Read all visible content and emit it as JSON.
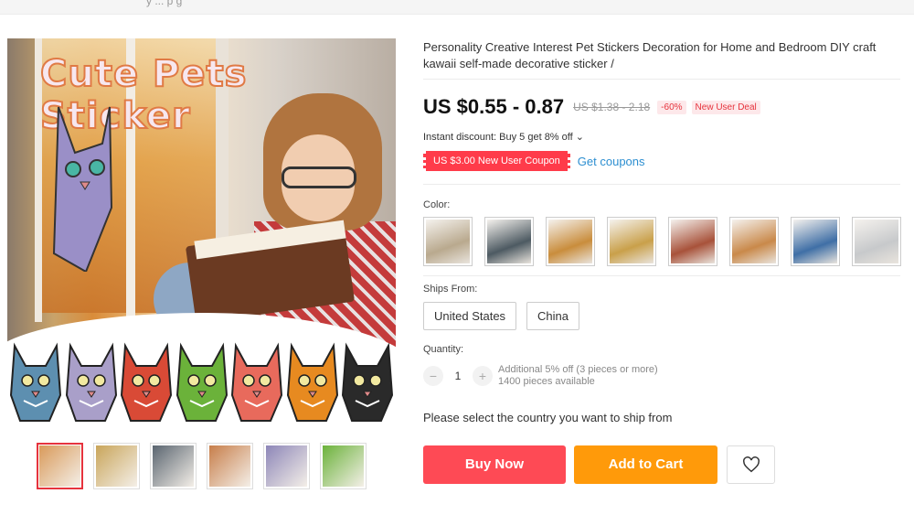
{
  "topbar": {
    "text": "y ... p g"
  },
  "gallery": {
    "headline": "Cute Pets Sticker",
    "sticker_colors": [
      "#5d8fb0",
      "#a99fc9",
      "#d94a36",
      "#6bb23a",
      "#e86a5c",
      "#e78a20",
      "#2a2a2a"
    ],
    "thumbnails": [
      {
        "name": "thumb-girl-reading-stickers",
        "color": "#d99a5a",
        "active": true
      },
      {
        "name": "thumb-sunny-room",
        "color": "#c9a55a",
        "active": false
      },
      {
        "name": "thumb-window-seat",
        "color": "#5a6570",
        "active": false
      },
      {
        "name": "thumb-girl-window",
        "color": "#c77e4a",
        "active": false
      },
      {
        "name": "thumb-grey-cat-sticker",
        "color": "#8d86b8",
        "active": false
      },
      {
        "name": "thumb-green-cat-sticker",
        "color": "#6bb23a",
        "active": false
      }
    ]
  },
  "product": {
    "title": "Personality Creative Interest Pet Stickers Decoration for Home and Bedroom DIY craft kawaii self-made decorative sticker /",
    "price": "US $0.55 - 0.87",
    "original_price": "US $1.38 - 2.18",
    "discount": "-60%",
    "new_user_deal": "New User Deal",
    "instant_discount": "Instant discount: Buy 5 get 8% off",
    "coupon": "US $3.00 New User Coupon",
    "get_coupons": "Get coupons",
    "color_label": "Color:",
    "color_swatches": [
      {
        "name": "swatch-grey-cat",
        "color": "#b9a98e"
      },
      {
        "name": "swatch-girl-reading",
        "color": "#4d5a62"
      },
      {
        "name": "swatch-window-cat",
        "color": "#c98d3c"
      },
      {
        "name": "swatch-flowers",
        "color": "#c9a04a"
      },
      {
        "name": "swatch-red-room",
        "color": "#a8523a"
      },
      {
        "name": "swatch-girl-window",
        "color": "#c9894a"
      },
      {
        "name": "swatch-car",
        "color": "#3f6fa6"
      },
      {
        "name": "swatch-grey-window",
        "color": "#c7c9cb"
      }
    ],
    "ships_from_label": "Ships From:",
    "ships_from_options": [
      "United States",
      "China"
    ],
    "quantity_label": "Quantity:",
    "quantity": "1",
    "quantity_minus": "−",
    "quantity_plus": "+",
    "additional_off": "Additional 5% off (3 pieces or more)",
    "available": "1400 pieces available",
    "ship_note": "Please select the country you want to ship from",
    "buy_now": "Buy Now",
    "add_to_cart": "Add to Cart"
  },
  "colors": {
    "accent_red": "#fe4a55",
    "accent_orange": "#ff9a0a",
    "link_blue": "#2d8fd1"
  }
}
